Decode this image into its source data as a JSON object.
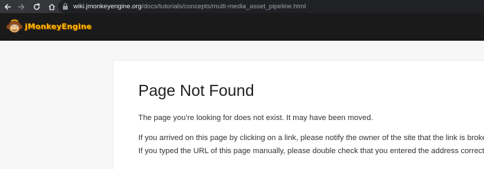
{
  "browser": {
    "url_host": "wiki.jmonkeyengine.org",
    "url_path": "/docs/tutorials/concepts/multi-media_asset_pipeline.html",
    "icons": [
      "back-arrow-icon",
      "forward-arrow-icon",
      "reload-icon",
      "home-icon",
      "lock-icon"
    ]
  },
  "site": {
    "logo_text": "jMonkeyEngine",
    "logo_icon": "monkey-mascot-icon",
    "colors": {
      "header_bg": "#1a1a1a",
      "logo_text": "#f5b800"
    }
  },
  "content": {
    "title": "Page Not Found",
    "paragraph_1": "The page you’re looking for does not exist. It may have been moved.",
    "paragraph_2_line_1": "If you arrived on this page by clicking on a link, please notify the owner of the site that the link is broken.",
    "paragraph_2_line_2": "If you typed the URL of this page manually, please double check that you entered the address correctly."
  }
}
